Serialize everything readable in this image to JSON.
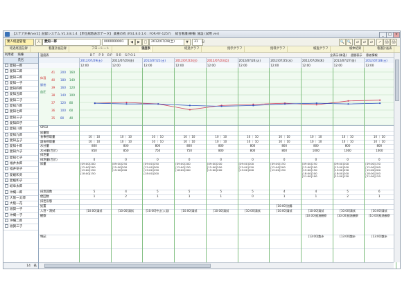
{
  "window": {
    "title": "【ステア外来/ver2】記録システム V1.3.8.1.4 【単位総数表示データ】 貴重の有 (RS1.8.0.1.0 : FOR-RF-1257) 　総合看護(療養) 施設 (試用 ver)",
    "min": "_",
    "max": "□",
    "close": "×"
  },
  "toolbar": {
    "record_button": "業人経過管理",
    "patient_icon": "人",
    "patient_name": "愛知一郎",
    "patient_id": "0000000001",
    "prev": "◀",
    "next": "▶",
    "date_icon": "□",
    "date_value": "2012/07/28(土)",
    "date_next": "▼",
    "days_value": "31",
    "days_unit": "日",
    "right_icons": [
      "🔍",
      "🔍",
      "⇄",
      "⇄",
      "⇄",
      "↗",
      "🖨",
      "🖨"
    ]
  },
  "tabs": [
    {
      "label": "経過経過記録"
    },
    {
      "label": "看護計画記録"
    },
    {
      "label": "フローシート"
    },
    {
      "label": "温度表",
      "active": true
    },
    {
      "label": "経過グラフ"
    },
    {
      "label": "指示グラフ"
    },
    {
      "label": "指導グラフ"
    },
    {
      "label": "検査グラフ"
    },
    {
      "label": "検体結果"
    },
    {
      "label": "看護計画表"
    }
  ],
  "left_panel": {
    "tabs": "利用者 　病棟",
    "header": "氏名",
    "patients": [
      "愛知一郎",
      "愛知二郎",
      "愛知三郎",
      "愛知一子",
      "愛知四郎",
      "愛知五郎",
      "愛知二子",
      "愛知六郎",
      "愛知七郎",
      "愛知三子",
      "愛知四子",
      "愛知八郎",
      "愛知九郎",
      "愛知五子",
      "愛知十郎",
      "愛知六子",
      "愛知七子",
      "福井太郎",
      "福井花子",
      "愛媛和夫",
      "愛媛和子",
      "岐阜太郎",
      "沖縄一郎",
      "大阪一太郎",
      "大阪一花",
      "滋賀一子",
      "沖縄一子",
      "沖縄二郎",
      "滋賀三子"
    ],
    "footer": "14　名"
  },
  "options": {
    "labels": "温度表　　　　　　　　　　　　　　ＢＴ　ＰＲ　ＢＰ　ＲＲ　ＳＰＯ２",
    "right": "全表示(体温) 　週間表示 　患者情報"
  },
  "dates": [
    {
      "date": "2012/07/29(土)",
      "time": "12:00",
      "color": "blue"
    },
    {
      "date": "2012/07/20(金)",
      "time": "12:00",
      "color": "black"
    },
    {
      "date": "2012/07/21(土)",
      "time": "12:00",
      "color": "blue"
    },
    {
      "date": "2012/07/22(日)",
      "time": "12:00",
      "color": "red"
    },
    {
      "date": "2012/07/23(月)",
      "time": "12:00",
      "color": "red"
    },
    {
      "date": "2012/07/24(火)",
      "time": "12:00",
      "color": "black"
    },
    {
      "date": "2012/07/25(水)",
      "time": "12:00",
      "color": "black"
    },
    {
      "date": "2012/07/26(木)",
      "time": "12:00",
      "color": "black"
    },
    {
      "date": "2012/07/27(金)",
      "time": "12:00",
      "color": "black"
    },
    {
      "date": "2012/07/28(土)",
      "time": "12:00",
      "color": "blue"
    }
  ],
  "vital_axis": {
    "labels": [
      "体温",
      "脈拍",
      "血圧"
    ],
    "ticks": [
      [
        "41",
        "200",
        "160"
      ],
      [
        "40",
        "180",
        "140"
      ],
      [
        "39",
        "160",
        "120"
      ],
      [
        "38",
        "140",
        "100"
      ],
      [
        "37",
        "120",
        "80"
      ],
      [
        "36",
        "100",
        "60"
      ],
      [
        "35",
        "80",
        "40"
      ]
    ]
  },
  "vital_series": {
    "pulse": [
      118,
      120,
      116,
      101,
      112,
      115,
      118,
      114,
      124,
      126
    ],
    "temp": [
      36.9,
      36.8,
      36.8,
      36.6,
      36.5,
      36.6,
      36.8,
      36.9,
      36.8,
      36.9
    ]
  },
  "rows": [
    {
      "label": "SPO2",
      "values": [
        "",
        "",
        "",
        "",
        "",
        "",
        "",
        "",
        "",
        ""
      ]
    },
    {
      "label": "尿量数",
      "values": [
        "",
        "",
        "",
        "",
        "",
        "",
        "",
        "",
        "",
        ""
      ]
    },
    {
      "label": "食事摂取量",
      "values": [
        "10 ｜ 10",
        "10 ｜ 10",
        "10 ｜ 10",
        "10 ｜ 10",
        "10 ｜ 10",
        "10 ｜ 10",
        "10 ｜ 10",
        "10 ｜ 10",
        "10 ｜ 10",
        "10 ｜ 10"
      ]
    },
    {
      "label": "副食摂取量",
      "values": [
        "10 ｜ 10",
        "10 ｜ 10",
        "10 ｜ 10",
        "10 ｜ 10",
        "10 ｜ 10",
        "10 ｜ 10",
        "10 ｜ 10",
        "10 ｜ 10",
        "10 ｜ 10",
        "10 ｜ 10"
      ]
    },
    {
      "label": "水分量",
      "values": [
        "800",
        "800",
        "800",
        "800",
        "800",
        "800",
        "800",
        "800",
        "800",
        "800"
      ]
    },
    {
      "label": "水分量(合計)",
      "values": [
        "850",
        "850",
        "750",
        "750",
        "800",
        "800",
        "800",
        "1000",
        "1000",
        "1000"
      ]
    },
    {
      "label": "排泄量",
      "values": [
        "",
        "",
        "",
        "",
        "",
        "",
        "",
        "",
        "",
        ""
      ]
    },
    {
      "label": "排泄量(合計)",
      "values": [
        "0",
        "0",
        "0",
        "0",
        "0",
        "0",
        "0",
        "0",
        "0",
        "0"
      ]
    },
    {
      "label": "尿量",
      "values": [
        "",
        "",
        "",
        "",
        "",
        "",
        "",
        "",
        "",
        ""
      ]
    }
  ],
  "urine_notes": [
    "[09:00]200\n[12:00]200\n[15:00]150\n[18:00]150",
    "[09:00]250\n[12:00]200\n[15:00]200",
    "[09:00]250\n[12:00]200\n[15:00]150\n[18:00]200",
    "[09:00]200\n[12:00]150\n[18:00]200",
    "[09:00]200\n[12:00]200\n[15:00]200",
    "[09:00]200\n[12:00]150\n[15:00]200",
    "[09:00]150\n[12:00]200\n[15:00]150",
    "[09:00]250\n[12:00]200\n[15:00]150\n[18:00]200\n[21:00]100",
    "[09:00]200\n[12:00]200\n[15:00]250\n[18:00]200\n[21:00]150",
    "[09:00]150\n[12:00]200\n[15:00]200\n[18:00]200\n[21:00]150"
  ],
  "rows2": [
    {
      "label": "排泄回数",
      "values": [
        "5",
        "4",
        "5",
        "5",
        "5",
        "5",
        "4",
        "4",
        "5",
        "6"
      ]
    },
    {
      "label": "便回数",
      "values": [
        "1",
        "2",
        "1",
        "1",
        "1",
        "0",
        "1",
        "1",
        "2",
        "1"
      ]
    },
    {
      "label": "排泄形態",
      "values": [
        "",
        "",
        "",
        "",
        "",
        "",
        "",
        "",
        "",
        ""
      ]
    },
    {
      "label": "処置",
      "values": [
        "",
        "",
        "",
        "",
        "",
        "",
        "[10:00]浣腸",
        "",
        "",
        ""
      ]
    },
    {
      "label": "入浴・清拭",
      "values": [
        "[10:00]清拭",
        "[10:00]清拭",
        "[10:00]中止(入浴)",
        "[10:00]清拭",
        "[10:00]清拭",
        "[10:00]清拭",
        "[10:00]清拭",
        "[10:00]清拭",
        "[10:00]清拭",
        "[10:00]清拭"
      ]
    },
    {
      "label": "観察",
      "values": [
        "",
        "",
        "",
        "",
        "",
        "",
        "",
        "[10:00]経過観察",
        "[10:00]経過観察",
        "[10:00]経過観察"
      ]
    },
    {
      "label": "特記",
      "values": [
        "",
        "",
        "",
        "",
        "",
        "",
        "",
        "[13:00]散歩",
        "[13:00]散歩",
        "[13:00]散歩"
      ]
    }
  ]
}
